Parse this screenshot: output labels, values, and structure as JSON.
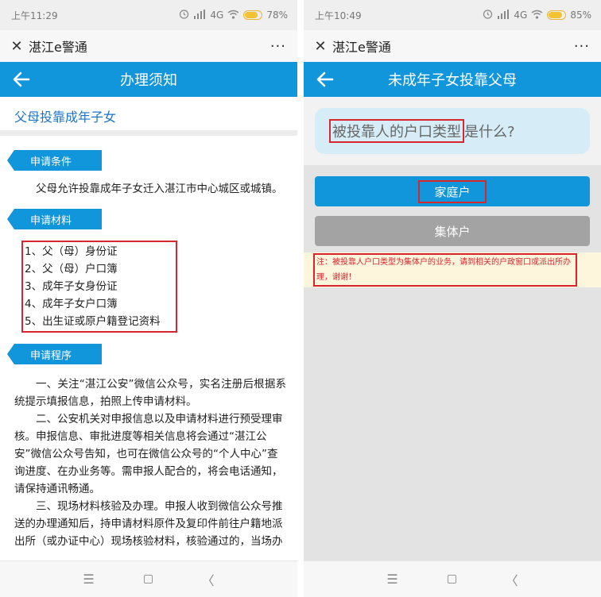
{
  "left": {
    "status": {
      "time": "上午11:29",
      "network": "4G",
      "battery_text": "78%",
      "battery_level": 0.78
    },
    "app_title": "湛江e警通",
    "more_label": "···",
    "nav_title": "办理须知",
    "page_heading": "父母投靠成年子女",
    "sections": {
      "conditions": {
        "tag": "申请条件",
        "text": "父母允许投靠成年子女迁入湛江市中心城区或城镇。"
      },
      "materials": {
        "tag": "申请材料",
        "items": [
          "1、父（母）身份证",
          "2、父（母）户口簿",
          "3、成年子女身份证",
          "4、成年子女户口簿",
          "5、出生证或原户籍登记资料"
        ]
      },
      "procedure": {
        "tag": "申请程序",
        "paragraphs": [
          "一、关注“湛江公安”微信公众号，实名注册后根据系统提示填报信息，拍照上传申请材料。",
          "二、公安机关对申报信息以及申请材料进行预受理审核。申报信息、审批进度等相关信息将会通过“湛江公安”微信公众号告知，也可在微信公众号的“个人中心”查询进度、在办业务等。需申报人配合的，将会电话通知，请保持通讯畅通。",
          "三、现场材料核验及办理。申报人收到微信公众号推送的办理通知后，持申请材料原件及复印件前往户籍地派出所（或办证中心）现场核验材料，核验通过的，当场办"
        ]
      }
    }
  },
  "right": {
    "status": {
      "time": "上午10:49",
      "network": "4G",
      "battery_text": "85%",
      "battery_level": 0.85
    },
    "app_title": "湛江e警通",
    "more_label": "···",
    "nav_title": "未成年子女投靠父母",
    "question": {
      "highlight": "被投靠人的户口类型",
      "rest": "是什么?"
    },
    "buttons": {
      "family": "家庭户",
      "collective": "集体户"
    },
    "note": "注：被投靠人户口类型为集体户的业务，请到相关的户政窗口或派出所办理，谢谢！"
  },
  "system_nav": {
    "menu": "☰",
    "back": "〈"
  },
  "colors": {
    "primary": "#1296db",
    "highlight": "#d8262f",
    "disabled": "#a3a3a3",
    "question_bg": "#d6edf7",
    "note_bg": "#fdf6dc"
  },
  "icons": {
    "close": "close-icon",
    "back": "back-arrow-icon",
    "alarm": "alarm-icon",
    "signal": "signal-icon",
    "wifi": "wifi-icon",
    "battery": "battery-icon"
  }
}
